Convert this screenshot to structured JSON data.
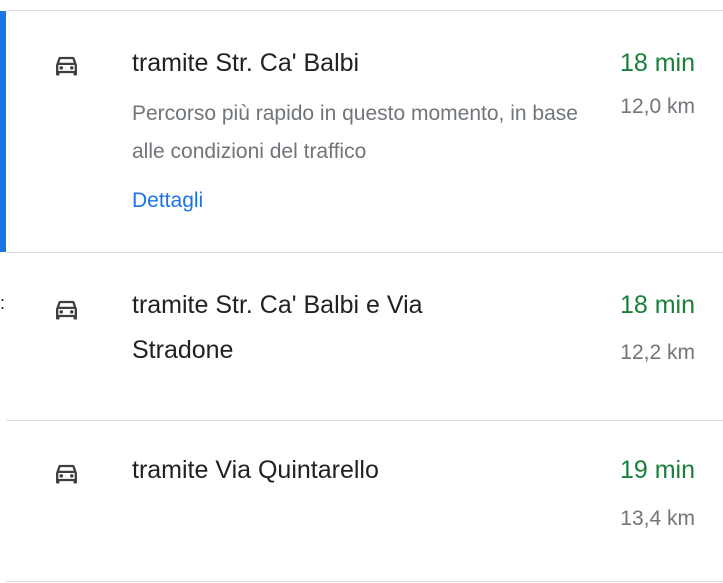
{
  "routes": [
    {
      "title": "tramite Str. Ca' Balbi",
      "description": "Percorso più rapido in questo momento, in base alle condizioni del traffico",
      "details_link": "Dettagli",
      "duration": "18 min",
      "distance": "12,0 km",
      "selected": true,
      "icon": "car-icon"
    },
    {
      "title": "tramite Str. Ca' Balbi e Via Stradone",
      "duration": "18 min",
      "distance": "12,2 km",
      "selected": false,
      "icon": "car-icon"
    },
    {
      "title": "tramite Via Quintarello",
      "duration": "19 min",
      "distance": "13,4 km",
      "selected": false,
      "icon": "car-icon"
    }
  ],
  "edge_mark": ":",
  "colors": {
    "accent": "#1a73e8",
    "duration": "#188038",
    "secondary_text": "#70757a",
    "primary_text": "#202124",
    "divider": "#dadce0"
  }
}
